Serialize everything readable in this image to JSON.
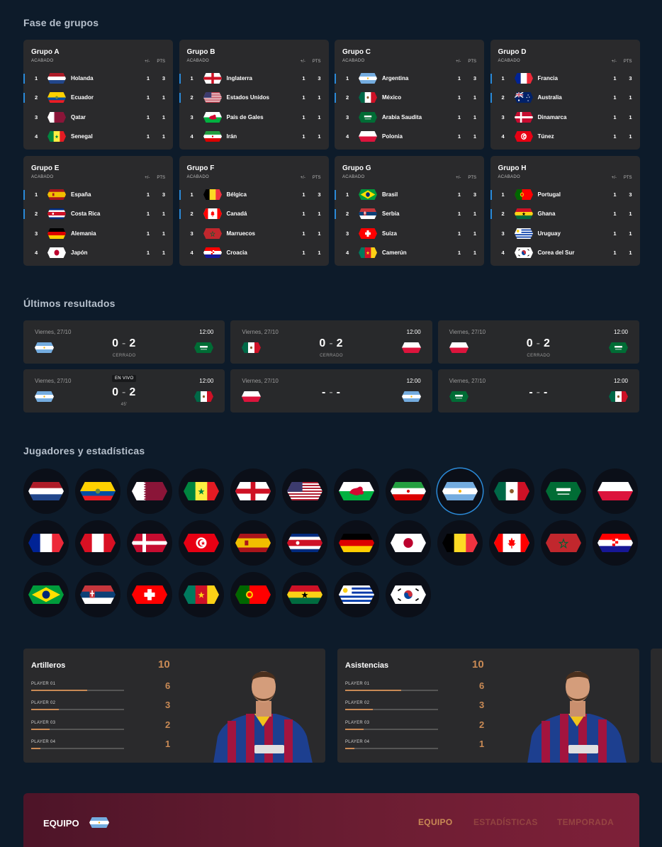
{
  "sections": {
    "groups_title": "Fase de grupos",
    "results_title": "Últimos resultados",
    "players_title": "Jugadores y estadísticas"
  },
  "groups": [
    {
      "name": "Grupo A",
      "status": "ACABADO",
      "col_diff": "+/-",
      "col_pts": "PTS",
      "rows": [
        {
          "pos": "1",
          "team": "Holanda",
          "flag": "netherlands",
          "diff": "1",
          "pts": "3"
        },
        {
          "pos": "2",
          "team": "Ecuador",
          "flag": "ecuador",
          "diff": "1",
          "pts": "1"
        },
        {
          "pos": "3",
          "team": "Qatar",
          "flag": "qatar",
          "diff": "1",
          "pts": "1"
        },
        {
          "pos": "4",
          "team": "Senegal",
          "flag": "senegal",
          "diff": "1",
          "pts": "1"
        }
      ]
    },
    {
      "name": "Grupo B",
      "status": "ACABADO",
      "col_diff": "+/-",
      "col_pts": "PTS",
      "rows": [
        {
          "pos": "1",
          "team": "Inglaterra",
          "flag": "england",
          "diff": "1",
          "pts": "3"
        },
        {
          "pos": "2",
          "team": "Estados Unidos",
          "flag": "usa",
          "diff": "1",
          "pts": "1"
        },
        {
          "pos": "3",
          "team": "País de Gales",
          "flag": "wales",
          "diff": "1",
          "pts": "1"
        },
        {
          "pos": "4",
          "team": "Irán",
          "flag": "iran",
          "diff": "1",
          "pts": "1"
        }
      ]
    },
    {
      "name": "Grupo C",
      "status": "ACABADO",
      "col_diff": "+/-",
      "col_pts": "PTS",
      "rows": [
        {
          "pos": "1",
          "team": "Argentina",
          "flag": "argentina",
          "diff": "1",
          "pts": "3"
        },
        {
          "pos": "2",
          "team": "México",
          "flag": "mexico",
          "diff": "1",
          "pts": "1"
        },
        {
          "pos": "3",
          "team": "Arabia Saudita",
          "flag": "saudi",
          "diff": "1",
          "pts": "1"
        },
        {
          "pos": "4",
          "team": "Polonia",
          "flag": "poland",
          "diff": "1",
          "pts": "1"
        }
      ]
    },
    {
      "name": "Grupo D",
      "status": "ACABADO",
      "col_diff": "+/-",
      "col_pts": "PTS",
      "rows": [
        {
          "pos": "1",
          "team": "Francia",
          "flag": "france",
          "diff": "1",
          "pts": "3"
        },
        {
          "pos": "2",
          "team": "Australia",
          "flag": "australia",
          "diff": "1",
          "pts": "1"
        },
        {
          "pos": "3",
          "team": "Dinamarca",
          "flag": "denmark",
          "diff": "1",
          "pts": "1"
        },
        {
          "pos": "4",
          "team": "Túnez",
          "flag": "tunisia",
          "diff": "1",
          "pts": "1"
        }
      ]
    },
    {
      "name": "Grupo E",
      "status": "ACABADO",
      "col_diff": "+/-",
      "col_pts": "PTS",
      "rows": [
        {
          "pos": "1",
          "team": "España",
          "flag": "spain",
          "diff": "1",
          "pts": "3"
        },
        {
          "pos": "2",
          "team": "Costa Rica",
          "flag": "costarica",
          "diff": "1",
          "pts": "1"
        },
        {
          "pos": "3",
          "team": "Alemania",
          "flag": "germany",
          "diff": "1",
          "pts": "1"
        },
        {
          "pos": "4",
          "team": "Japón",
          "flag": "japan",
          "diff": "1",
          "pts": "1"
        }
      ]
    },
    {
      "name": "Grupo F",
      "status": "ACABADO",
      "col_diff": "+/-",
      "col_pts": "PTS",
      "rows": [
        {
          "pos": "1",
          "team": "Bélgica",
          "flag": "belgium",
          "diff": "1",
          "pts": "3"
        },
        {
          "pos": "2",
          "team": "Canadá",
          "flag": "canada",
          "diff": "1",
          "pts": "1"
        },
        {
          "pos": "3",
          "team": "Marruecos",
          "flag": "morocco",
          "diff": "1",
          "pts": "1"
        },
        {
          "pos": "4",
          "team": "Croacia",
          "flag": "croatia",
          "diff": "1",
          "pts": "1"
        }
      ]
    },
    {
      "name": "Grupo G",
      "status": "ACABADO",
      "col_diff": "+/-",
      "col_pts": "PTS",
      "rows": [
        {
          "pos": "1",
          "team": "Brasil",
          "flag": "brazil",
          "diff": "1",
          "pts": "3"
        },
        {
          "pos": "2",
          "team": "Serbia",
          "flag": "serbia",
          "diff": "1",
          "pts": "1"
        },
        {
          "pos": "3",
          "team": "Suiza",
          "flag": "switzerland",
          "diff": "1",
          "pts": "1"
        },
        {
          "pos": "4",
          "team": "Camerún",
          "flag": "cameroon",
          "diff": "1",
          "pts": "1"
        }
      ]
    },
    {
      "name": "Grupo H",
      "status": "ACABADO",
      "col_diff": "+/-",
      "col_pts": "PTS",
      "rows": [
        {
          "pos": "1",
          "team": "Portugal",
          "flag": "portugal",
          "diff": "1",
          "pts": "3"
        },
        {
          "pos": "2",
          "team": "Ghana",
          "flag": "ghana",
          "diff": "1",
          "pts": "1"
        },
        {
          "pos": "3",
          "team": "Uruguay",
          "flag": "uruguay",
          "diff": "1",
          "pts": "1"
        },
        {
          "pos": "4",
          "team": "Corea del Sur",
          "flag": "korea",
          "diff": "1",
          "pts": "1"
        }
      ]
    }
  ],
  "results": [
    {
      "date": "Viernes, 27/10",
      "time": "12:00",
      "home": "argentina",
      "away": "saudi",
      "home_score": "0",
      "away_score": "2",
      "sep": "-",
      "status": "CERRADO",
      "live": ""
    },
    {
      "date": "Viernes, 27/10",
      "time": "12:00",
      "home": "mexico",
      "away": "poland",
      "home_score": "0",
      "away_score": "2",
      "sep": "-",
      "status": "CERRADO",
      "live": ""
    },
    {
      "date": "Viernes, 27/10",
      "time": "12:00",
      "home": "poland",
      "away": "saudi",
      "home_score": "0",
      "away_score": "2",
      "sep": "-",
      "status": "CERRADO",
      "live": ""
    },
    {
      "date": "Viernes, 27/10",
      "time": "12:00",
      "home": "argentina",
      "away": "mexico",
      "home_score": "0",
      "away_score": "2",
      "sep": "-",
      "status": "45'",
      "live": "EN VIVO"
    },
    {
      "date": "Viernes, 27/10",
      "time": "12:00",
      "home": "poland",
      "away": "argentina",
      "home_score": "-",
      "away_score": "-",
      "sep": "-",
      "status": "",
      "live": ""
    },
    {
      "date": "Viernes, 27/10",
      "time": "12:00",
      "home": "saudi",
      "away": "mexico",
      "home_score": "-",
      "away_score": "-",
      "sep": "-",
      "status": "",
      "live": ""
    }
  ],
  "team_flags": [
    "netherlands",
    "ecuador",
    "qatar",
    "senegal",
    "england",
    "usa",
    "wales",
    "iran",
    "argentina",
    "mexico",
    "saudi",
    "poland",
    "france",
    "peru",
    "denmark",
    "tunisia",
    "spain",
    "costarica",
    "germany",
    "japan",
    "belgium",
    "canada",
    "morocco",
    "croatia",
    "brazil",
    "serbia",
    "switzerland",
    "cameroon",
    "portugal",
    "ghana",
    "uruguay",
    "korea"
  ],
  "selected_flag": "argentina",
  "stats": [
    {
      "title": "Artilleros",
      "total": "10",
      "players": [
        {
          "name": "PLAYER 01",
          "value": "6",
          "progress": 0.6
        },
        {
          "name": "PLAYER 02",
          "value": "3",
          "progress": 0.3
        },
        {
          "name": "PLAYER 03",
          "value": "2",
          "progress": 0.2
        },
        {
          "name": "PLAYER 04",
          "value": "1",
          "progress": 0.1
        }
      ]
    },
    {
      "title": "Asistencias",
      "total": "10",
      "players": [
        {
          "name": "PLAYER 01",
          "value": "6",
          "progress": 0.6
        },
        {
          "name": "PLAYER 02",
          "value": "3",
          "progress": 0.3
        },
        {
          "name": "PLAYER 03",
          "value": "2",
          "progress": 0.2
        },
        {
          "name": "PLAYER 04",
          "value": "1",
          "progress": 0.1
        }
      ]
    }
  ],
  "bottom": {
    "team_label": "EQUIPO",
    "team_flag": "argentina",
    "tabs": [
      {
        "label": "EQUIPO",
        "active": true
      },
      {
        "label": "ESTADÍSTICAS",
        "active": false
      },
      {
        "label": "TEMPORADA",
        "active": false
      }
    ]
  },
  "colors": {
    "background": "#0d1b2a",
    "card": "#2a2a2c",
    "accent_blue": "#2b8ad8",
    "accent_gold": "#c98a55",
    "bottom_bar": "#6b1d32"
  }
}
